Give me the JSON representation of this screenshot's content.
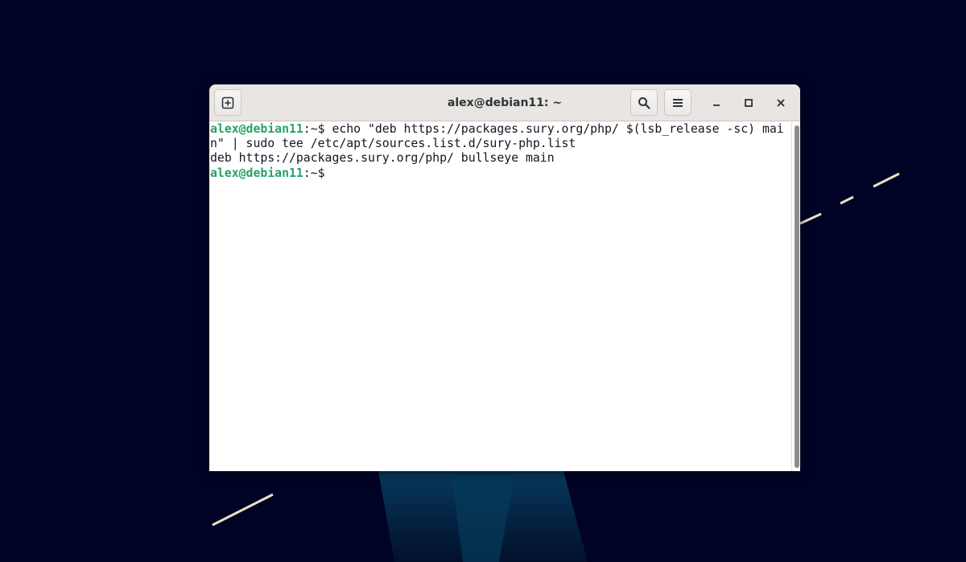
{
  "window": {
    "title": "alex@debian11: ~"
  },
  "headerbar": {
    "new_tab_icon": "new-tab-icon",
    "search_icon": "search-icon",
    "menu_icon": "hamburger-menu-icon",
    "minimize_icon": "minimize-icon",
    "maximize_icon": "maximize-icon",
    "close_icon": "close-icon"
  },
  "terminal": {
    "lines": [
      {
        "prompt_user": "alex@debian11",
        "prompt_path": ":~$ ",
        "text": "echo \"deb https://packages.sury.org/php/ $(lsb_release -sc) mai"
      },
      {
        "prompt_user": "",
        "prompt_path": "",
        "text": "n\" | sudo tee /etc/apt/sources.list.d/sury-php.list"
      },
      {
        "prompt_user": "",
        "prompt_path": "",
        "text": "deb https://packages.sury.org/php/ bullseye main"
      },
      {
        "prompt_user": "alex@debian11",
        "prompt_path": ":~$ ",
        "text": ""
      }
    ]
  },
  "colors": {
    "desktop_background": "#000326",
    "prompt_user": "#26a269",
    "terminal_text": "#171421",
    "headerbar": "#e8e5e2"
  }
}
